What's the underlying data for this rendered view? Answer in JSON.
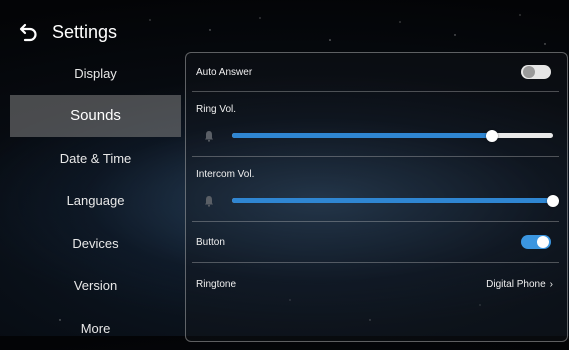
{
  "header": {
    "title": "Settings",
    "back_icon": "back-arrow-icon"
  },
  "sidebar": {
    "items": [
      {
        "label": "Display",
        "active": false
      },
      {
        "label": "Sounds",
        "active": true
      },
      {
        "label": "Date & Time",
        "active": false
      },
      {
        "label": "Language",
        "active": false
      },
      {
        "label": "Devices",
        "active": false
      },
      {
        "label": "Version",
        "active": false
      },
      {
        "label": "More",
        "active": false
      }
    ]
  },
  "sounds": {
    "auto_answer": {
      "label": "Auto Answer",
      "on": false
    },
    "ring_vol": {
      "label": "Ring Vol.",
      "level": 0.81,
      "icon": "bell-icon"
    },
    "intercom_vol": {
      "label": "Intercom Vol.",
      "level": 1.0,
      "icon": "bell-icon"
    },
    "button": {
      "label": "Button",
      "on": true
    },
    "ringtone": {
      "label": "Ringtone",
      "value": "Digital Phone",
      "icon": "chevron-right-icon"
    }
  },
  "colors": {
    "accent": "#2f86d2",
    "active_item_bg": "#828282"
  }
}
